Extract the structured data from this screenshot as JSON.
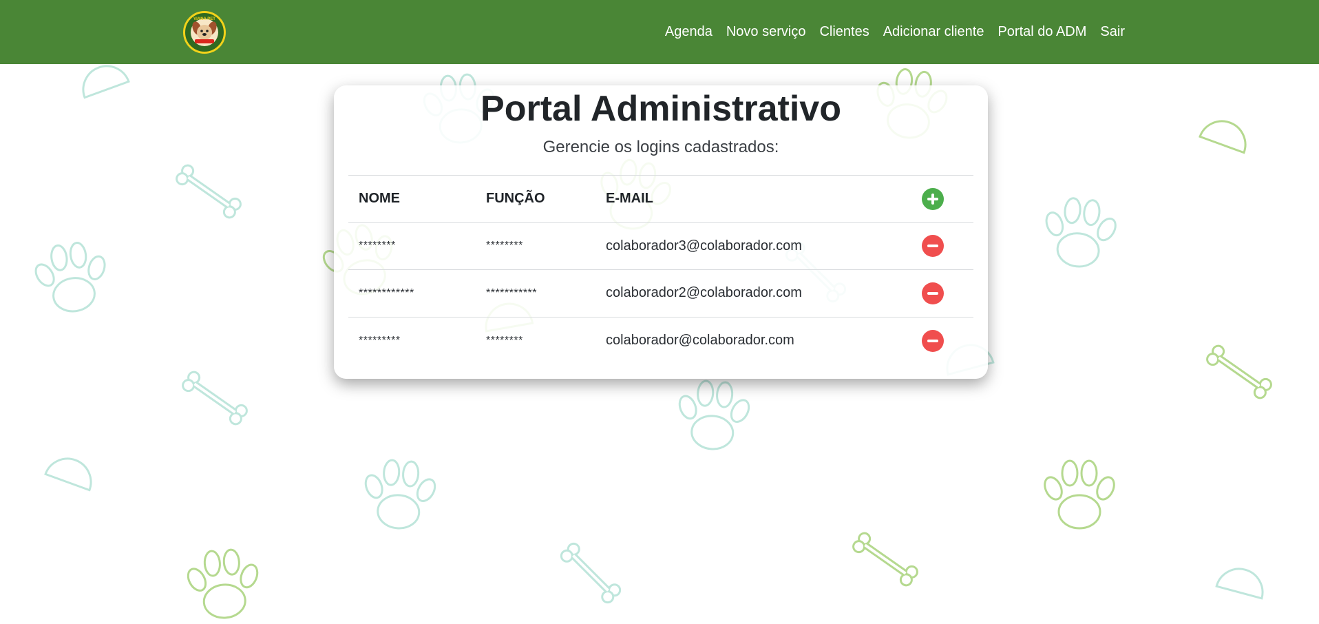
{
  "nav": {
    "brand_text": "VIANA PET",
    "links": [
      "Agenda",
      "Novo serviço",
      "Clientes",
      "Adicionar cliente",
      "Portal do ADM",
      "Sair"
    ]
  },
  "page": {
    "title": "Portal Administrativo",
    "subtitle": "Gerencie os logins cadastrados:"
  },
  "table": {
    "headers": [
      "NOME",
      "FUNÇÃO",
      "E-MAIL"
    ],
    "rows": [
      {
        "name": "********",
        "role": "********",
        "email": "colaborador3@colaborador.com"
      },
      {
        "name": "************",
        "role": "***********",
        "email": "colaborador2@colaborador.com"
      },
      {
        "name": "*********",
        "role": "********",
        "email": "colaborador@colaborador.com"
      }
    ]
  },
  "icons": {
    "add": "plus-circle-icon",
    "remove": "minus-circle-icon",
    "background": [
      "paw-icon",
      "bone-icon",
      "bowl-icon"
    ]
  },
  "colors": {
    "navbar": "#4a8636",
    "add_button": "#4cae4c",
    "remove_button": "#f04e4e",
    "pattern_teal": "#bfe6dc",
    "pattern_green": "#b5d98f"
  }
}
